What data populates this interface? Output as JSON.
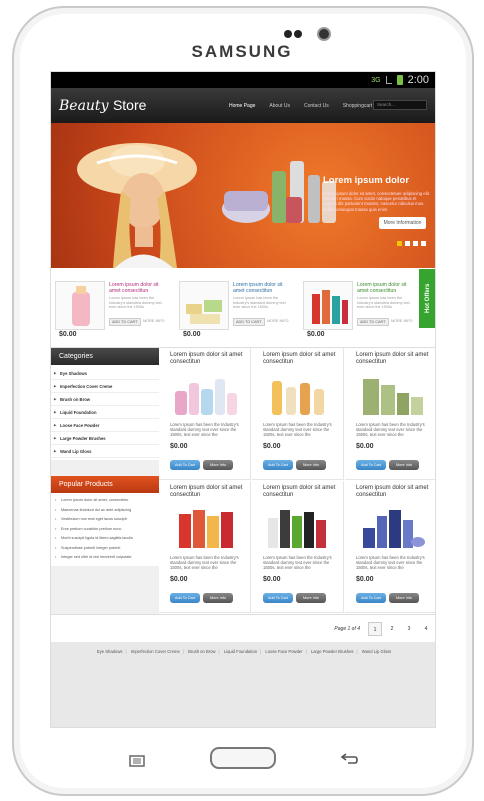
{
  "device": {
    "brand": "SAMSUNG"
  },
  "status": {
    "time": "2:00",
    "signal": "3G"
  },
  "header": {
    "logo_italic": "Beauty",
    "logo_rest": "Store",
    "nav": [
      "Home Page",
      "About Us",
      "Contact Us",
      "Shoppingcart"
    ],
    "search_placeholder": "Search..."
  },
  "hero": {
    "title": "Lorem ipsum dolor",
    "text": "Lorem ipsum dolor sit amet, consectetuer adipiscing elit. Aenean massa. Cum sociis natoque penatibus et magnis dis parturient montes, nascetur ridiculus mus. Nulla consequat massa quis enim.",
    "button": "More Information"
  },
  "hot_offers": {
    "tab": "Hot Offers",
    "items": [
      {
        "title": "Lorem ipsum dolor sit amet consectitun",
        "desc": "Lorem Ipsum has been the Industry's standard dummy text ever since the 1500s.",
        "add": "ADD TO CART",
        "more": "MORE INFO",
        "price": "$0.00"
      },
      {
        "title": "Lorem ipsum dolor sit amet consectitun",
        "desc": "Lorem Ipsum has been the Industry's standard dummy text ever since the 1500s.",
        "add": "ADD TO CART",
        "more": "MORE INFO",
        "price": "$0.00"
      },
      {
        "title": "Lorem ipsum dolor sit amet consectitun",
        "desc": "Lorem Ipsum has been the Industry's standard dummy text ever since the 1500s.",
        "add": "ADD TO CART",
        "more": "MORE INFO",
        "price": "$0.00"
      }
    ]
  },
  "categories": {
    "heading": "Categories",
    "items": [
      "Eye Shadows",
      "Imperfection Cover Creme",
      "Brush on Brow",
      "Liquid Foundation",
      "Loose Face Powder",
      "Large Powder Brushes",
      "Wand Lip Gloss"
    ]
  },
  "popular": {
    "heading": "Popular Products",
    "items": [
      "Lorem ipsum dolor sit amet, consectetur",
      "Maecenas tincidunt dui ac ante adipiscing",
      "Vestibulum non erat eget lacus suscipit",
      "Eros pretium curabitur pretium nunc",
      "Morbi suscipit ligula id libero sagittis iaculis",
      "Suspendisse potenti integer potenti",
      "Integer sed nibh id nisi hendrerit vulputate"
    ]
  },
  "products": [
    {
      "title": "Lorem ipsum dolor sit amet consectitun",
      "desc": "Lorem Ipsum has been the Industry's standard dummy text ever since the 1500s, text ever since the",
      "price": "$0.00",
      "add": "Add To Cart",
      "more": "More Info"
    },
    {
      "title": "Lorem ipsum dolor sit amet consectitun",
      "desc": "Lorem Ipsum has been the Industry's standard dummy text ever since the 1500s, text ever since the",
      "price": "$0.00",
      "add": "Add To Cart",
      "more": "More Info"
    },
    {
      "title": "Lorem ipsum dolor sit amet consectitun",
      "desc": "Lorem Ipsum has been the Industry's standard dummy text ever since the 1500s, text ever since the",
      "price": "$0.00",
      "add": "Add To Cart",
      "more": "More Info"
    },
    {
      "title": "Lorem ipsum dolor sit amet consectitun",
      "desc": "Lorem Ipsum has been the Industry's standard dummy text ever since the 1500s, text ever since the",
      "price": "$0.00",
      "add": "Add To Cart",
      "more": "More Info"
    },
    {
      "title": "Lorem ipsum dolor sit amet consectitun",
      "desc": "Lorem Ipsum has been the Industry's standard dummy text ever since the 1500s, text ever since the",
      "price": "$0.00",
      "add": "Add To Cart",
      "more": "More Info"
    },
    {
      "title": "Lorem ipsum dolor sit amet consectitun",
      "desc": "Lorem Ipsum has been the Industry's standard dummy text ever since the 1500s, text ever since the",
      "price": "$0.00",
      "add": "Add To Cart",
      "more": "More Info"
    }
  ],
  "pager": {
    "label": "Page 1 of 4",
    "pages": [
      "1",
      "2",
      "3",
      "4"
    ]
  },
  "footer": {
    "links": [
      "Eye Shadows",
      "Imperfection Cover Creme",
      "Brush on Brow",
      "Liquid Foundation",
      "Loose Face Powder",
      "Large Powder Brushes",
      "Wand Lip Gloss"
    ]
  },
  "colors": {
    "accent": "#e15320",
    "hot_tab": "#35a52f",
    "button_blue": "#3b86c6"
  },
  "icons": {
    "home": "home-button",
    "menu": "menu-icon",
    "back": "back-icon"
  }
}
